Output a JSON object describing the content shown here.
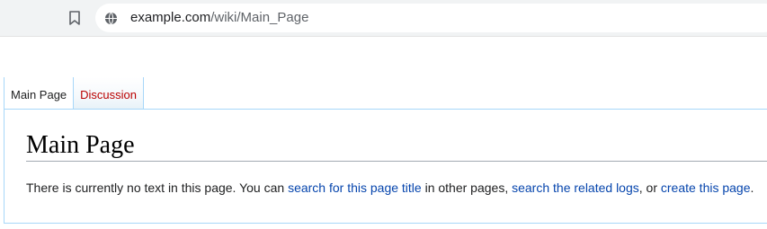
{
  "browser": {
    "url_host": "example.com",
    "url_path": "/wiki/Main_Page"
  },
  "tabs": [
    {
      "label": "Main Page",
      "selected": true
    },
    {
      "label": "Discussion",
      "selected": false
    }
  ],
  "page": {
    "title": "Main Page",
    "text_1": "There is currently no text in this page. You can ",
    "link_1": "search for this page title",
    "text_2": " in other pages, ",
    "link_2": "search the related logs",
    "text_3": ", or ",
    "link_3": "create this page",
    "text_4": "."
  },
  "colors": {
    "link": "#0645ad",
    "new_link": "#ba0000",
    "tab_border": "#a7d7f9"
  }
}
